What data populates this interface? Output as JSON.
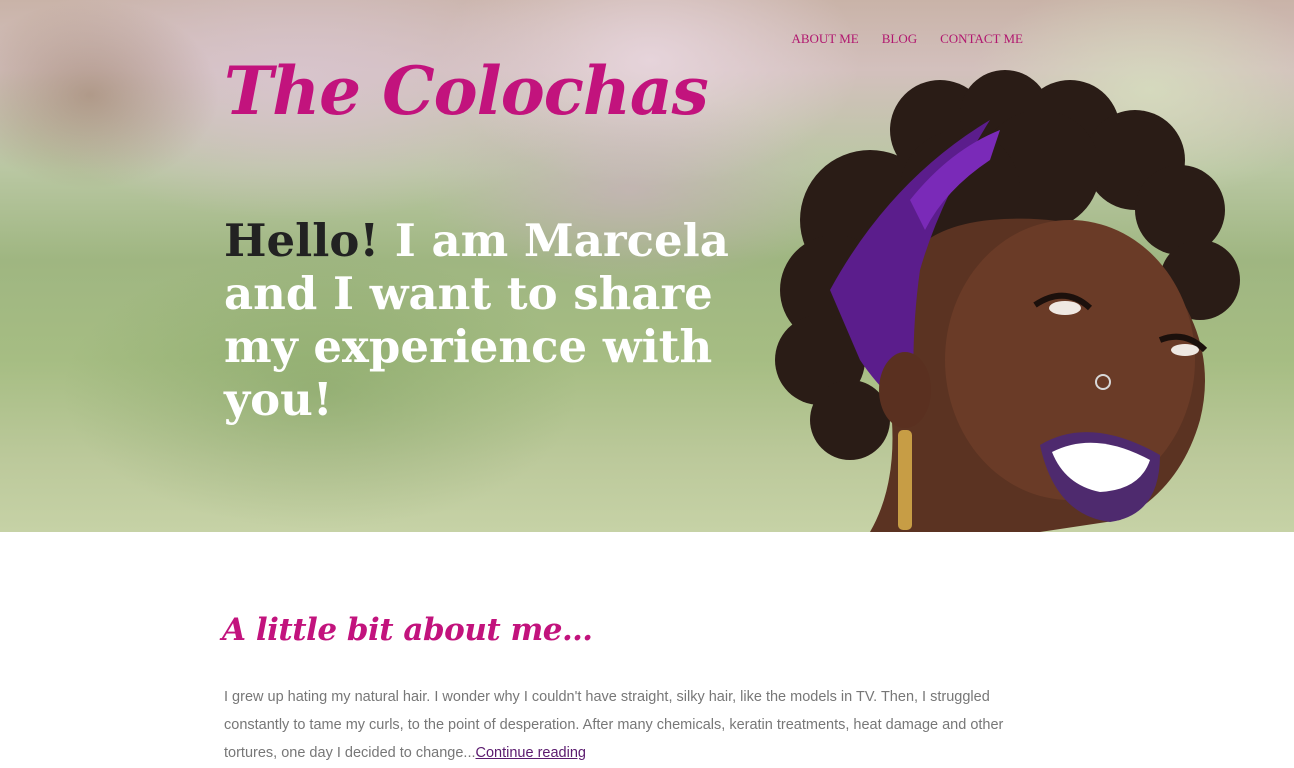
{
  "nav": {
    "items": [
      {
        "label": "ABOUT ME"
      },
      {
        "label": "BLOG"
      },
      {
        "label": "CONTACT ME"
      }
    ]
  },
  "site": {
    "title": "The Colochas"
  },
  "hero": {
    "hello": "Hello!",
    "message": " I am Marcela and I want to share my experience with you!"
  },
  "about": {
    "heading": "A little bit about me…",
    "text": "I grew up hating my natural hair. I wonder why I couldn't have straight, silky hair, like the models in TV. Then, I struggled constantly to tame my curls, to the point of desperation. After many chemicals, keratin treatments, heat damage and other tortures, one day I decided to change...",
    "link": "Continue reading"
  },
  "colors": {
    "accent": "#c2137d",
    "nav": "#b1176f",
    "body_text": "#777777",
    "link": "#5a1a6e"
  }
}
